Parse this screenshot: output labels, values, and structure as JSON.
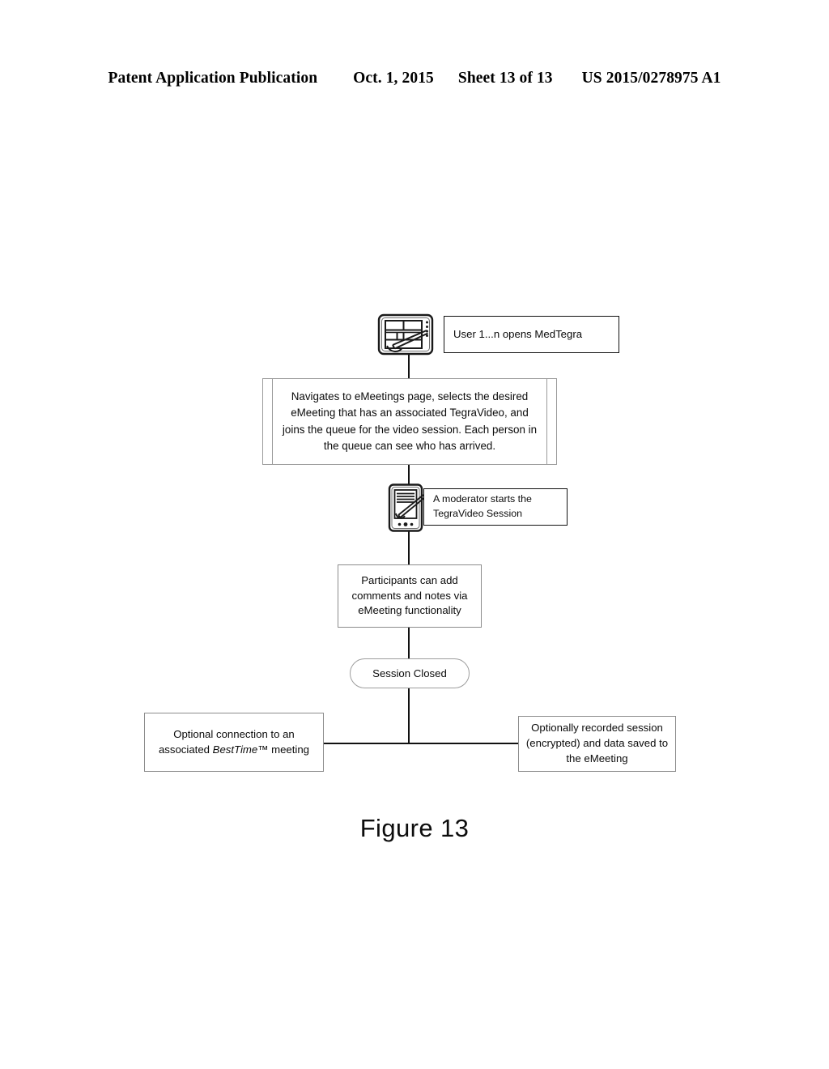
{
  "header": {
    "publication": "Patent Application Publication",
    "date": "Oct. 1, 2015",
    "sheet": "Sheet 13 of 13",
    "number": "US 2015/0278975 A1"
  },
  "figure": {
    "caption": "Figure 13",
    "number": "13"
  },
  "flow": {
    "nodes": [
      {
        "id": "user-opens",
        "type": "box",
        "label": "User 1...n opens MedTegra",
        "icon": "tablet-stylus-icon"
      },
      {
        "id": "navigate-emeetings",
        "type": "document-box",
        "label": "Navigates to eMeetings page, selects the desired eMeeting that has an associated TegraVideo, and joins the queue for the video session. Each person in the queue can see who has arrived."
      },
      {
        "id": "moderator-starts",
        "type": "box",
        "label": "A moderator starts the TegraVideo Session",
        "icon": "phone-stylus-icon"
      },
      {
        "id": "participants-comment",
        "type": "box",
        "label": "Participants can add comments and notes via eMeeting functionality"
      },
      {
        "id": "session-closed",
        "type": "pill",
        "label": "Session Closed"
      },
      {
        "id": "optional-besttime",
        "type": "box",
        "label_part_1": "Optional connection to an",
        "label_part_2a": "associated ",
        "label_part_2b": "BestTime™",
        "label_part_2c": "  meeting"
      },
      {
        "id": "optional-recorded",
        "type": "box",
        "label": "Optionally recorded session (encrypted) and data saved to the eMeeting"
      }
    ]
  },
  "colors": {
    "ink": "#000000",
    "box_border": "#3f3f3f",
    "light_border": "#9a9a9a",
    "page_background": "#ffffff"
  }
}
